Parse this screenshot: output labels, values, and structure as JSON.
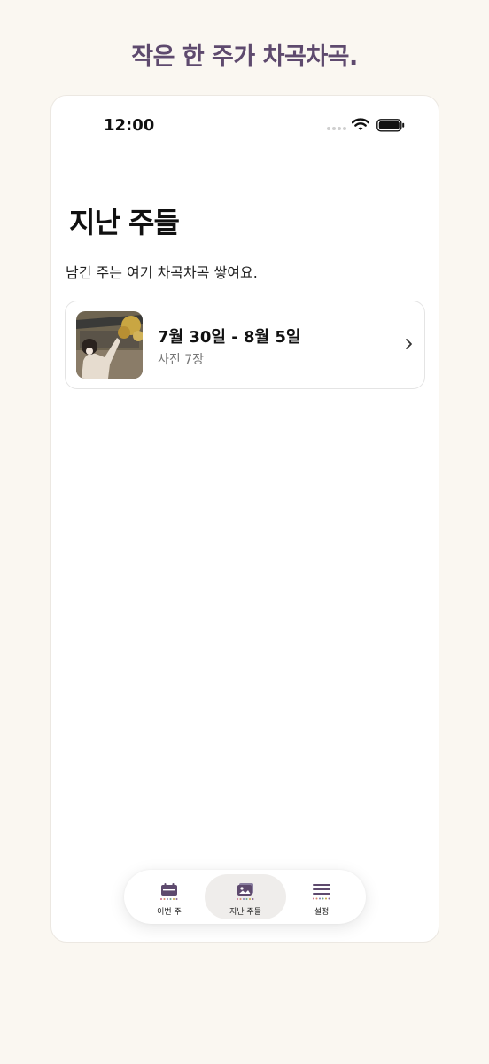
{
  "promo": {
    "headline": "작은 한 주가 차곡차곡."
  },
  "status_bar": {
    "time": "12:00"
  },
  "page": {
    "title": "지난 주들",
    "subtitle": "남긴 주는 여기 차곡차곡 쌓여요."
  },
  "weeks": [
    {
      "date_range": "7월 30일 - 8월 5일",
      "photo_count": "사진 7장"
    }
  ],
  "tab_bar": {
    "tabs": [
      {
        "label": "이번 주",
        "icon": "calendar-icon",
        "active": false
      },
      {
        "label": "지난 주들",
        "icon": "photo-stack-icon",
        "active": true
      },
      {
        "label": "설정",
        "icon": "settings-sliders-icon",
        "active": false
      }
    ]
  },
  "colors": {
    "accent": "#5e4a6e",
    "background": "#faf7f1",
    "active_tab": "#efedeb"
  }
}
